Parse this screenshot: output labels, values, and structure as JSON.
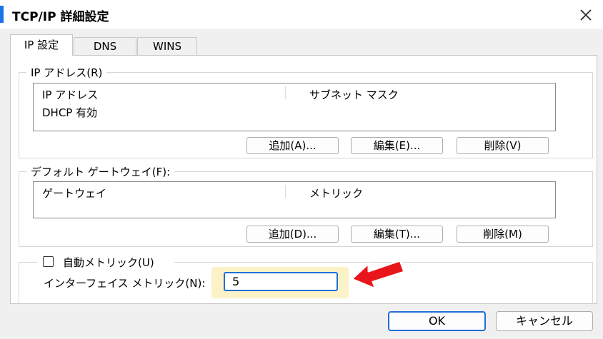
{
  "window": {
    "title": "TCP/IP 詳細設定"
  },
  "tabs": [
    {
      "label": "IP 設定",
      "active": true
    },
    {
      "label": "DNS",
      "active": false
    },
    {
      "label": "WINS",
      "active": false
    }
  ],
  "ip_address": {
    "group_label": "IP アドレス(R)",
    "columns": [
      "IP アドレス",
      "サブネット マスク"
    ],
    "rows": [
      [
        "DHCP 有効",
        ""
      ]
    ],
    "buttons": {
      "add": "追加(A)...",
      "edit": "編集(E)...",
      "delete": "削除(V)"
    }
  },
  "gateway": {
    "group_label": "デフォルト ゲートウェイ(F):",
    "columns": [
      "ゲートウェイ",
      "メトリック"
    ],
    "buttons": {
      "add": "追加(D)...",
      "edit": "編集(T)...",
      "delete": "削除(M)"
    }
  },
  "auto_metric": {
    "label": "自動メトリック(U)",
    "checked": false,
    "interface_metric_label": "インターフェイス メトリック(N):",
    "interface_metric_value": "5"
  },
  "footer": {
    "ok": "OK",
    "cancel": "キャンセル"
  },
  "colors": {
    "accent": "#1f6fd6",
    "highlight": "#fbf3c7",
    "arrow": "#e8161b"
  },
  "icons": {
    "close": "close-icon",
    "pointer": "red-arrow-icon"
  }
}
